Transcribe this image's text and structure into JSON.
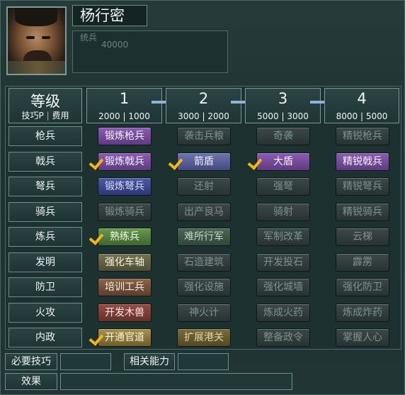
{
  "character": {
    "name": "杨行密",
    "info_faint_1": "统兵",
    "info_faint_2": "40000"
  },
  "header": {
    "level_title": "等级",
    "sub_left": "技巧P",
    "sub_sep": "|",
    "sub_right": "费用",
    "levels": [
      {
        "num": "1",
        "p": "2000",
        "cost": "1000"
      },
      {
        "num": "2",
        "p": "3000",
        "cost": "2000"
      },
      {
        "num": "3",
        "p": "5000",
        "cost": "3000"
      },
      {
        "num": "4",
        "p": "8000",
        "cost": "5000"
      }
    ]
  },
  "rows": [
    {
      "label": "枪兵",
      "cells": [
        {
          "text": "锻炼枪兵",
          "style": "purple",
          "checked": false
        },
        {
          "text": "袭击兵粮",
          "style": "dim",
          "checked": false
        },
        {
          "text": "奇袭",
          "style": "dim",
          "checked": false
        },
        {
          "text": "精锐枪兵",
          "style": "dim",
          "checked": false
        }
      ]
    },
    {
      "label": "戟兵",
      "cells": [
        {
          "text": "锻炼戟兵",
          "style": "purple",
          "checked": true
        },
        {
          "text": "箭盾",
          "style": "ind",
          "checked": true
        },
        {
          "text": "大盾",
          "style": "purple",
          "checked": true
        },
        {
          "text": "精锐戟兵",
          "style": "purple",
          "checked": false
        }
      ]
    },
    {
      "label": "弩兵",
      "cells": [
        {
          "text": "锻炼弩兵",
          "style": "blue",
          "checked": false
        },
        {
          "text": "还射",
          "style": "dim",
          "checked": false
        },
        {
          "text": "强弩",
          "style": "dim",
          "checked": false
        },
        {
          "text": "精锐弩兵",
          "style": "dim",
          "checked": false
        }
      ]
    },
    {
      "label": "骑兵",
      "cells": [
        {
          "text": "锻炼骑兵",
          "style": "dim",
          "checked": false
        },
        {
          "text": "出产良马",
          "style": "dim",
          "checked": false
        },
        {
          "text": "骑射",
          "style": "dim",
          "checked": false
        },
        {
          "text": "精锐骑兵",
          "style": "dim",
          "checked": false
        }
      ]
    },
    {
      "label": "炼兵",
      "cells": [
        {
          "text": "熟练兵",
          "style": "green",
          "checked": true
        },
        {
          "text": "难所行军",
          "style": "dimteal",
          "checked": false
        },
        {
          "text": "军制改革",
          "style": "dim",
          "checked": false
        },
        {
          "text": "云梯",
          "style": "dim",
          "checked": false
        }
      ]
    },
    {
      "label": "发明",
      "cells": [
        {
          "text": "强化车轴",
          "style": "olive",
          "checked": false
        },
        {
          "text": "石造建筑",
          "style": "dim",
          "checked": false
        },
        {
          "text": "开发投石",
          "style": "dim",
          "checked": false
        },
        {
          "text": "霹雳",
          "style": "dim",
          "checked": false
        }
      ]
    },
    {
      "label": "防卫",
      "cells": [
        {
          "text": "培训工兵",
          "style": "brown",
          "checked": false
        },
        {
          "text": "强化设施",
          "style": "dim",
          "checked": false
        },
        {
          "text": "强化城墙",
          "style": "dim",
          "checked": false
        },
        {
          "text": "强化防卫",
          "style": "dim",
          "checked": false
        }
      ]
    },
    {
      "label": "火攻",
      "cells": [
        {
          "text": "开发木兽",
          "style": "rust",
          "checked": false
        },
        {
          "text": "神火计",
          "style": "dim",
          "checked": false
        },
        {
          "text": "炼成火药",
          "style": "dim",
          "checked": false
        },
        {
          "text": "炼成炸药",
          "style": "dim",
          "checked": false
        }
      ]
    },
    {
      "label": "内政",
      "cells": [
        {
          "text": "开通官道",
          "style": "gold",
          "checked": true
        },
        {
          "text": "扩展港关",
          "style": "dimgold",
          "checked": false
        },
        {
          "text": "整备政令",
          "style": "dim",
          "checked": false
        },
        {
          "text": "掌握人心",
          "style": "dim",
          "checked": false
        }
      ]
    }
  ],
  "footer": {
    "required_label": "必要技巧",
    "related_label": "相关能力",
    "effect_label": "效果"
  }
}
